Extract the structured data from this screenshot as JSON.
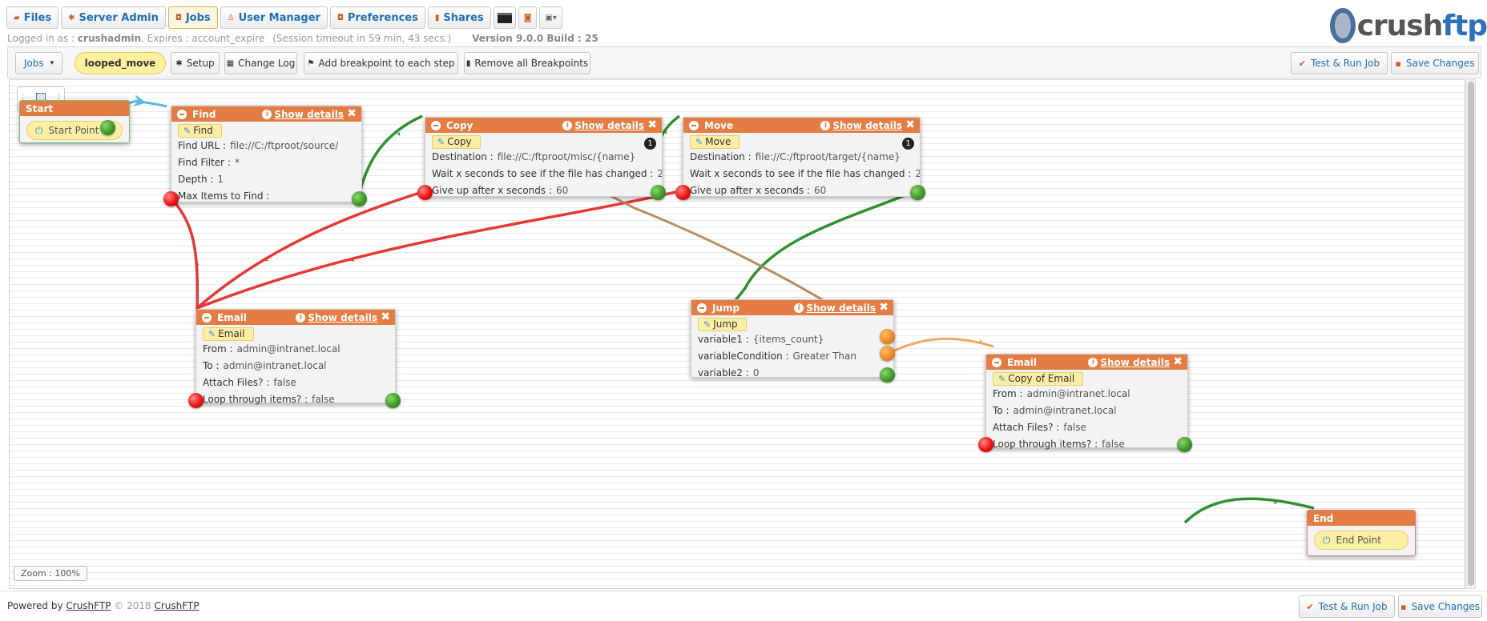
{
  "nav": {
    "tabs": [
      {
        "label": "Files",
        "icon": "folder-icon"
      },
      {
        "label": "Server Admin",
        "icon": "gear-icon"
      },
      {
        "label": "Jobs",
        "icon": "jobs-icon"
      },
      {
        "label": "User Manager",
        "icon": "user-icon"
      },
      {
        "label": "Preferences",
        "icon": "preferences-icon"
      },
      {
        "label": "Shares",
        "icon": "share-icon"
      }
    ],
    "active_tab": "Jobs",
    "extra_icons": [
      "terminal-icon",
      "plugin-icon",
      "image-dropdown-icon"
    ]
  },
  "logo": {
    "text_a": "crush",
    "text_b": "ftp"
  },
  "session": {
    "prefix": "Logged in as :",
    "user": "crushadmin",
    "expires_label": ", Expires :",
    "expires": "account_expire",
    "timeout": "(Session timeout in 59 min, 43 secs.)",
    "version": "Version 9.0.0 Build : 25"
  },
  "toolbar": {
    "jobs_dropdown": "Jobs",
    "job_name": "looped_move",
    "setup": "Setup",
    "change_log": "Change Log",
    "add_breakpoints": "Add breakpoint to each step",
    "remove_breakpoints": "Remove all Breakpoints",
    "test_run": "Test & Run Job",
    "save": "Save Changes"
  },
  "canvas": {
    "zoom": "Zoom : 100%",
    "show_details": "Show details",
    "start": {
      "title": "Start",
      "point": "Start Point"
    },
    "end": {
      "title": "End",
      "point": "End Point"
    },
    "find": {
      "title": "Find",
      "tag": "Find",
      "props": [
        {
          "k": "Find URL :",
          "v": "file://C:/ftproot/source/"
        },
        {
          "k": "Find Filter :",
          "v": "*"
        },
        {
          "k": "Depth :",
          "v": "1"
        },
        {
          "k": "Max Items to Find :",
          "v": ""
        }
      ]
    },
    "copy": {
      "title": "Copy",
      "tag": "Copy",
      "badge": "1",
      "props": [
        {
          "k": "Destination :",
          "v": "file://C:/ftproot/misc/{name}"
        },
        {
          "k": "Wait x seconds to see if the file has changed :",
          "v": "2"
        },
        {
          "k": "Give up after x seconds :",
          "v": "60"
        }
      ]
    },
    "move": {
      "title": "Move",
      "tag": "Move",
      "badge": "1",
      "props": [
        {
          "k": "Destination :",
          "v": "file://C:/ftproot/target/{name}"
        },
        {
          "k": "Wait x seconds to see if the file has changed :",
          "v": "2"
        },
        {
          "k": "Give up after x seconds :",
          "v": "60"
        }
      ]
    },
    "email1": {
      "title": "Email",
      "tag": "Email",
      "props": [
        {
          "k": "From :",
          "v": "admin@intranet.local"
        },
        {
          "k": "To :",
          "v": "admin@intranet.local"
        },
        {
          "k": "Attach Files? :",
          "v": "false"
        },
        {
          "k": "Loop through items? :",
          "v": "false"
        }
      ]
    },
    "jump": {
      "title": "Jump",
      "tag": "Jump",
      "props": [
        {
          "k": "variable1 :",
          "v": "{items_count}"
        },
        {
          "k": "variableCondition :",
          "v": "Greater Than"
        },
        {
          "k": "variable2 :",
          "v": "0"
        }
      ]
    },
    "email2": {
      "title": "Email",
      "tag": "Copy of Email",
      "props": [
        {
          "k": "From :",
          "v": "admin@intranet.local"
        },
        {
          "k": "To :",
          "v": "admin@intranet.local"
        },
        {
          "k": "Attach Files? :",
          "v": "false"
        },
        {
          "k": "Loop through items? :",
          "v": "false"
        }
      ]
    }
  },
  "footer": {
    "powered_by": "Powered by",
    "link1": "CrushFTP",
    "copyright": "© 2018",
    "link2": "CrushFTP",
    "test_run": "Test & Run Job",
    "save": "Save Changes"
  },
  "colors": {
    "header_orange": "#e47d43",
    "success_wire": "#2e9130",
    "failure_wire": "#e53935",
    "start_wire": "#5bb8e6",
    "jump_wire": "#f0a865",
    "link_blue": "#1f6fb5"
  }
}
